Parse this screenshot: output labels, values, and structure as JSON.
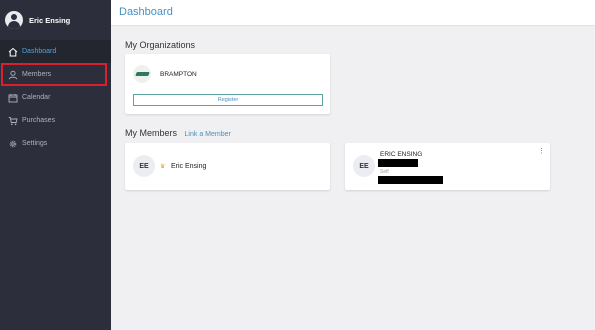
{
  "user": {
    "name": "Eric Ensing"
  },
  "nav": [
    {
      "label": "Dashboard",
      "icon": "home-icon"
    },
    {
      "label": "Members",
      "icon": "person-icon"
    },
    {
      "label": "Calendar",
      "icon": "calendar-icon"
    },
    {
      "label": "Purchases",
      "icon": "cart-icon"
    },
    {
      "label": "Settings",
      "icon": "gear-icon"
    }
  ],
  "header": {
    "title": "Dashboard"
  },
  "organizations": {
    "title": "My Organizations",
    "items": [
      {
        "name": "BRAMPTON",
        "button": "Register"
      }
    ]
  },
  "members": {
    "title": "My Members",
    "link": "Link a Member",
    "items": [
      {
        "initials": "EE",
        "name": "Eric Ensing"
      },
      {
        "initials": "EE",
        "name": "ERIC ENSING",
        "label": "Self",
        "menu": "⋮"
      }
    ]
  },
  "colors": {
    "accent": "#4a8fbf",
    "sidebar": "#2c2f3b",
    "highlight": "#d8202f"
  }
}
